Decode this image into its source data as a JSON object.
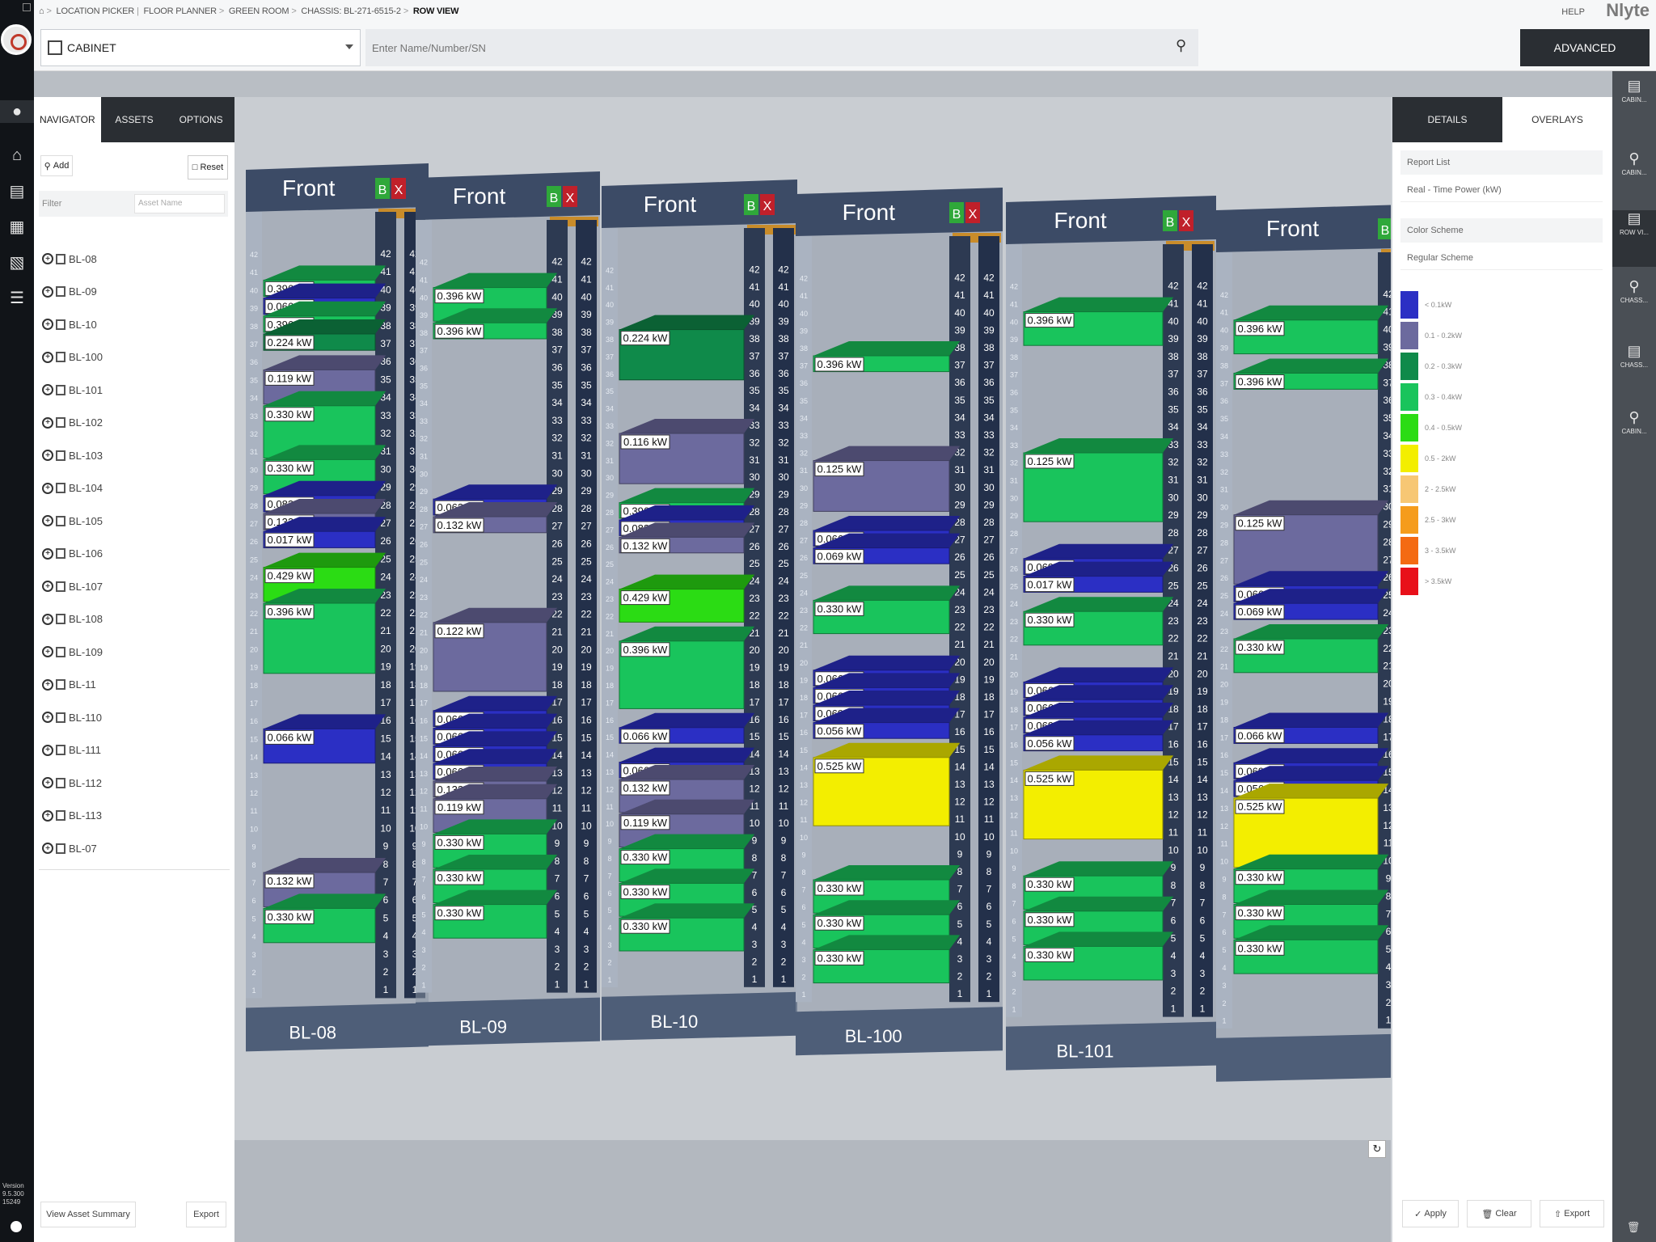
{
  "breadcrumb": [
    "LOCATION PICKER",
    "FLOOR PLANNER",
    "GREEN ROOM",
    "CHASSIS: BL-271-6515-2",
    "ROW VIEW"
  ],
  "help": "HELP",
  "brand": "Nlyte",
  "cabinet_select": "CABINET",
  "search_placeholder": "Enter Name/Number/SN",
  "advanced": "ADVANCED",
  "left_tabs": [
    "NAVIGATOR",
    "ASSETS",
    "OPTIONS"
  ],
  "add": "Add",
  "reset": "Reset",
  "filter": "Filter",
  "asset_name_placeholder": "Asset Name",
  "assets": [
    "BL-08",
    "BL-09",
    "BL-10",
    "BL-100",
    "BL-101",
    "BL-102",
    "BL-103",
    "BL-104",
    "BL-105",
    "BL-106",
    "BL-107",
    "BL-108",
    "BL-109",
    "BL-11",
    "BL-110",
    "BL-111",
    "BL-112",
    "BL-113",
    "BL-07"
  ],
  "view_asset_summary": "View Asset Summary",
  "export": "Export",
  "version": "Version 9.5.300 15249",
  "right_tabs": [
    "DETAILS",
    "OVERLAYS"
  ],
  "report_list": "Report List",
  "report_value": "Real - Time Power (kW)",
  "color_scheme": "Color Scheme",
  "color_scheme_value": "Regular Scheme",
  "legend": [
    {
      "label": "< 0.1kW",
      "color": "#2b2fc4"
    },
    {
      "label": "0.1 - 0.2kW",
      "color": "#6c6a9e"
    },
    {
      "label": "0.2 - 0.3kW",
      "color": "#0f8a4a"
    },
    {
      "label": "0.3 - 0.4kW",
      "color": "#19c45c"
    },
    {
      "label": "0.4 - 0.5kW",
      "color": "#2bdc14"
    },
    {
      "label": "0.5 - 2kW",
      "color": "#f3ee00"
    },
    {
      "label": "2 - 2.5kW",
      "color": "#f7c774"
    },
    {
      "label": "2.5 - 3kW",
      "color": "#f59c1c"
    },
    {
      "label": "3 - 3.5kW",
      "color": "#f46a12"
    },
    {
      "label": "> 3.5kW",
      "color": "#e8101a"
    }
  ],
  "apply": "Apply",
  "clear": "Clear",
  "right_export": "Export",
  "far_rail": [
    "CABIN...",
    "ROW VI...",
    "CHASS...",
    "CABIN..."
  ],
  "racks": [
    {
      "name": "BL-08",
      "front": "Front",
      "devices": [
        {
          "u": 40,
          "h": 1,
          "kw": "0.396 kW",
          "c": "#19c45c"
        },
        {
          "u": 39,
          "h": 1,
          "kw": "0.066 kW",
          "c": "#2b2fc4"
        },
        {
          "u": 38,
          "h": 1,
          "kw": "0.396 kW",
          "c": "#19c45c"
        },
        {
          "u": 37,
          "h": 1,
          "kw": "0.224 kW",
          "c": "#0f8a4a"
        },
        {
          "u": 34,
          "h": 2,
          "kw": "0.119 kW",
          "c": "#6c6a9e"
        },
        {
          "u": 31,
          "h": 3,
          "kw": "0.330 kW",
          "c": "#19c45c"
        },
        {
          "u": 29,
          "h": 2,
          "kw": "0.330 kW",
          "c": "#19c45c"
        },
        {
          "u": 28,
          "h": 1,
          "kw": "0.083 kW",
          "c": "#2b2fc4"
        },
        {
          "u": 27,
          "h": 1,
          "kw": "0.132 kW",
          "c": "#6c6a9e"
        },
        {
          "u": 26,
          "h": 1,
          "kw": "0.017 kW",
          "c": "#2b2fc4"
        },
        {
          "u": 23,
          "h": 2,
          "kw": "0.429 kW",
          "c": "#2bdc14"
        },
        {
          "u": 19,
          "h": 4,
          "kw": "0.396 kW",
          "c": "#19c45c"
        },
        {
          "u": 14,
          "h": 2,
          "kw": "0.066 kW",
          "c": "#2b2fc4"
        },
        {
          "u": 6,
          "h": 2,
          "kw": "0.132 kW",
          "c": "#6c6a9e"
        },
        {
          "u": 4,
          "h": 2,
          "kw": "0.330 kW",
          "c": "#19c45c"
        }
      ]
    },
    {
      "name": "BL-09",
      "front": "Front",
      "devices": [
        {
          "u": 39,
          "h": 2,
          "kw": "0.396 kW",
          "c": "#19c45c"
        },
        {
          "u": 38,
          "h": 1,
          "kw": "0.396 kW",
          "c": "#19c45c"
        },
        {
          "u": 28,
          "h": 1,
          "kw": "0.063 kW",
          "c": "#2b2fc4"
        },
        {
          "u": 27,
          "h": 1,
          "kw": "0.132 kW",
          "c": "#6c6a9e"
        },
        {
          "u": 18,
          "h": 4,
          "kw": "0.122 kW",
          "c": "#6c6a9e"
        },
        {
          "u": 16,
          "h": 1,
          "kw": "0.066 kW",
          "c": "#2b2fc4"
        },
        {
          "u": 15,
          "h": 1,
          "kw": "0.066 kW",
          "c": "#2b2fc4"
        },
        {
          "u": 14,
          "h": 1,
          "kw": "0.066 kW",
          "c": "#2b2fc4"
        },
        {
          "u": 13,
          "h": 1,
          "kw": "0.066 kW",
          "c": "#2b2fc4"
        },
        {
          "u": 12,
          "h": 1,
          "kw": "0.132 kW",
          "c": "#6c6a9e"
        },
        {
          "u": 10,
          "h": 2,
          "kw": "0.119 kW",
          "c": "#6c6a9e"
        },
        {
          "u": 8,
          "h": 2,
          "kw": "0.330 kW",
          "c": "#19c45c"
        },
        {
          "u": 6,
          "h": 2,
          "kw": "0.330 kW",
          "c": "#19c45c"
        },
        {
          "u": 4,
          "h": 2,
          "kw": "0.330 kW",
          "c": "#19c45c"
        }
      ]
    },
    {
      "name": "BL-10",
      "front": "Front",
      "devices": [
        {
          "u": 36,
          "h": 3,
          "kw": "0.224 kW",
          "c": "#0f8a4a"
        },
        {
          "u": 30,
          "h": 3,
          "kw": "0.116 kW",
          "c": "#6c6a9e"
        },
        {
          "u": 28,
          "h": 1,
          "kw": "0.396 kW",
          "c": "#19c45c"
        },
        {
          "u": 27,
          "h": 1,
          "kw": "0.083 kW",
          "c": "#2b2fc4"
        },
        {
          "u": 26,
          "h": 1,
          "kw": "0.132 kW",
          "c": "#6c6a9e"
        },
        {
          "u": 22,
          "h": 2,
          "kw": "0.429 kW",
          "c": "#2bdc14"
        },
        {
          "u": 17,
          "h": 4,
          "kw": "0.396 kW",
          "c": "#19c45c"
        },
        {
          "u": 15,
          "h": 1,
          "kw": "0.066 kW",
          "c": "#2b2fc4"
        },
        {
          "u": 13,
          "h": 1,
          "kw": "0.066 kW",
          "c": "#2b2fc4"
        },
        {
          "u": 11,
          "h": 2,
          "kw": "0.132 kW",
          "c": "#6c6a9e"
        },
        {
          "u": 9,
          "h": 2,
          "kw": "0.119 kW",
          "c": "#6c6a9e"
        },
        {
          "u": 7,
          "h": 2,
          "kw": "0.330 kW",
          "c": "#19c45c"
        },
        {
          "u": 5,
          "h": 2,
          "kw": "0.330 kW",
          "c": "#19c45c"
        },
        {
          "u": 3,
          "h": 2,
          "kw": "0.330 kW",
          "c": "#19c45c"
        }
      ]
    },
    {
      "name": "BL-100",
      "front": "Front",
      "devices": [
        {
          "u": 37,
          "h": 1,
          "kw": "0.396 kW",
          "c": "#19c45c"
        },
        {
          "u": 29,
          "h": 3,
          "kw": "0.125 kW",
          "c": "#6c6a9e"
        },
        {
          "u": 27,
          "h": 1,
          "kw": "0.066 kW",
          "c": "#2b2fc4"
        },
        {
          "u": 26,
          "h": 1,
          "kw": "0.069 kW",
          "c": "#2b2fc4"
        },
        {
          "u": 22,
          "h": 2,
          "kw": "0.330 kW",
          "c": "#19c45c"
        },
        {
          "u": 19,
          "h": 1,
          "kw": "0.066 kW",
          "c": "#2b2fc4"
        },
        {
          "u": 18,
          "h": 1,
          "kw": "0.066 kW",
          "c": "#2b2fc4"
        },
        {
          "u": 17,
          "h": 1,
          "kw": "0.069 kW",
          "c": "#2b2fc4"
        },
        {
          "u": 16,
          "h": 1,
          "kw": "0.056 kW",
          "c": "#2b2fc4"
        },
        {
          "u": 11,
          "h": 4,
          "kw": "0.525 kW",
          "c": "#f3ee00"
        },
        {
          "u": 6,
          "h": 2,
          "kw": "0.330 kW",
          "c": "#19c45c"
        },
        {
          "u": 4,
          "h": 2,
          "kw": "0.330 kW",
          "c": "#19c45c"
        },
        {
          "u": 2,
          "h": 2,
          "kw": "0.330 kW",
          "c": "#19c45c"
        }
      ]
    },
    {
      "name": "BL-101",
      "front": "Front",
      "devices": [
        {
          "u": 39,
          "h": 2,
          "kw": "0.396 kW",
          "c": "#19c45c"
        },
        {
          "u": 29,
          "h": 4,
          "kw": "0.125 kW",
          "c": "#19c45c"
        },
        {
          "u": 26,
          "h": 1,
          "kw": "0.069 kW",
          "c": "#2b2fc4"
        },
        {
          "u": 25,
          "h": 1,
          "kw": "0.017 kW",
          "c": "#2b2fc4"
        },
        {
          "u": 22,
          "h": 2,
          "kw": "0.330 kW",
          "c": "#19c45c"
        },
        {
          "u": 19,
          "h": 1,
          "kw": "0.066 kW",
          "c": "#2b2fc4"
        },
        {
          "u": 18,
          "h": 1,
          "kw": "0.066 kW",
          "c": "#2b2fc4"
        },
        {
          "u": 17,
          "h": 1,
          "kw": "0.069 kW",
          "c": "#2b2fc4"
        },
        {
          "u": 16,
          "h": 1,
          "kw": "0.056 kW",
          "c": "#2b2fc4"
        },
        {
          "u": 11,
          "h": 4,
          "kw": "0.525 kW",
          "c": "#f3ee00"
        },
        {
          "u": 7,
          "h": 2,
          "kw": "0.330 kW",
          "c": "#19c45c"
        },
        {
          "u": 5,
          "h": 2,
          "kw": "0.330 kW",
          "c": "#19c45c"
        },
        {
          "u": 3,
          "h": 2,
          "kw": "0.330 kW",
          "c": "#19c45c"
        }
      ]
    },
    {
      "name": "",
      "front": "Front",
      "devices": [
        {
          "u": 39,
          "h": 2,
          "kw": "0.396 kW",
          "c": "#19c45c"
        },
        {
          "u": 37,
          "h": 1,
          "kw": "0.396 kW",
          "c": "#19c45c"
        },
        {
          "u": 26,
          "h": 4,
          "kw": "0.125 kW",
          "c": "#6c6a9e"
        },
        {
          "u": 25,
          "h": 1,
          "kw": "0.066 kW",
          "c": "#2b2fc4"
        },
        {
          "u": 24,
          "h": 1,
          "kw": "0.069 kW",
          "c": "#2b2fc4"
        },
        {
          "u": 21,
          "h": 2,
          "kw": "0.330 kW",
          "c": "#19c45c"
        },
        {
          "u": 17,
          "h": 1,
          "kw": "0.066 kW",
          "c": "#2b2fc4"
        },
        {
          "u": 15,
          "h": 1,
          "kw": "0.069 kW",
          "c": "#2b2fc4"
        },
        {
          "u": 14,
          "h": 1,
          "kw": "0.056 kW",
          "c": "#2b2fc4"
        },
        {
          "u": 10,
          "h": 4,
          "kw": "0.525 kW",
          "c": "#f3ee00"
        },
        {
          "u": 8,
          "h": 2,
          "kw": "0.330 kW",
          "c": "#19c45c"
        },
        {
          "u": 6,
          "h": 2,
          "kw": "0.330 kW",
          "c": "#19c45c"
        },
        {
          "u": 4,
          "h": 2,
          "kw": "0.330 kW",
          "c": "#19c45c"
        }
      ]
    }
  ]
}
